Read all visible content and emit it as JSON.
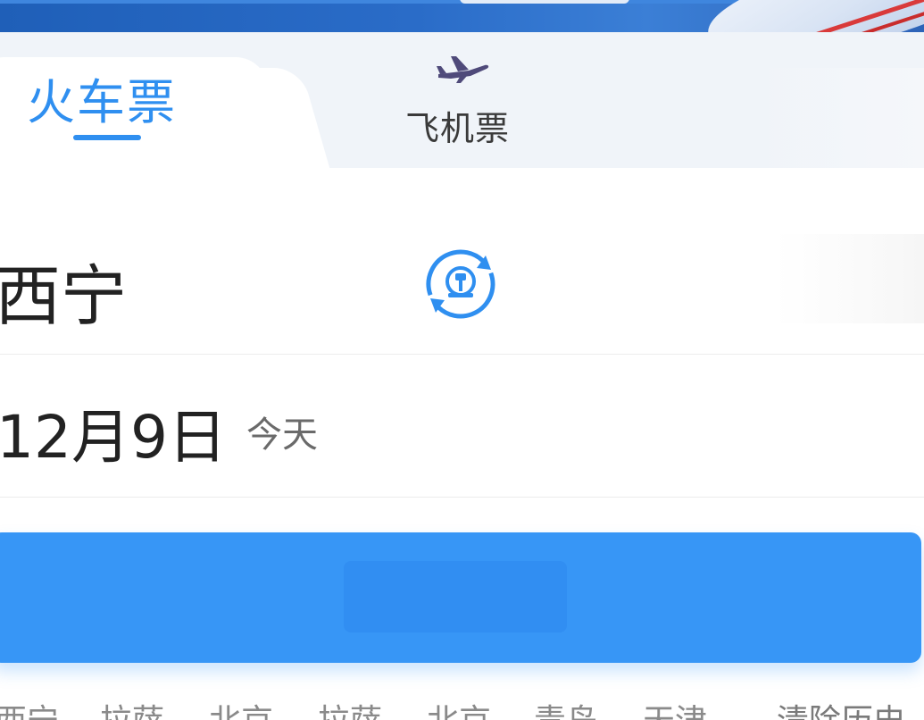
{
  "tabs": {
    "train_label": "火车票",
    "flight_label": "飞机票",
    "active": "train"
  },
  "booking": {
    "from_station": "西宁",
    "to_station": "",
    "date": "12月9日",
    "date_sub": "今天",
    "query_label": ""
  },
  "history": {
    "items": [
      "西宁",
      "拉萨",
      "北京",
      "拉萨",
      "北京",
      "青岛",
      "天津"
    ],
    "clear_label": "清除历史"
  },
  "icons": {
    "swap": "railway-swap-icon",
    "plane": "airplane-icon"
  },
  "colors": {
    "accent": "#2f8ff0",
    "button": "#3796f6",
    "text_primary": "#222222",
    "text_secondary": "#6a6a6a",
    "banner": "#2a6cc8"
  }
}
